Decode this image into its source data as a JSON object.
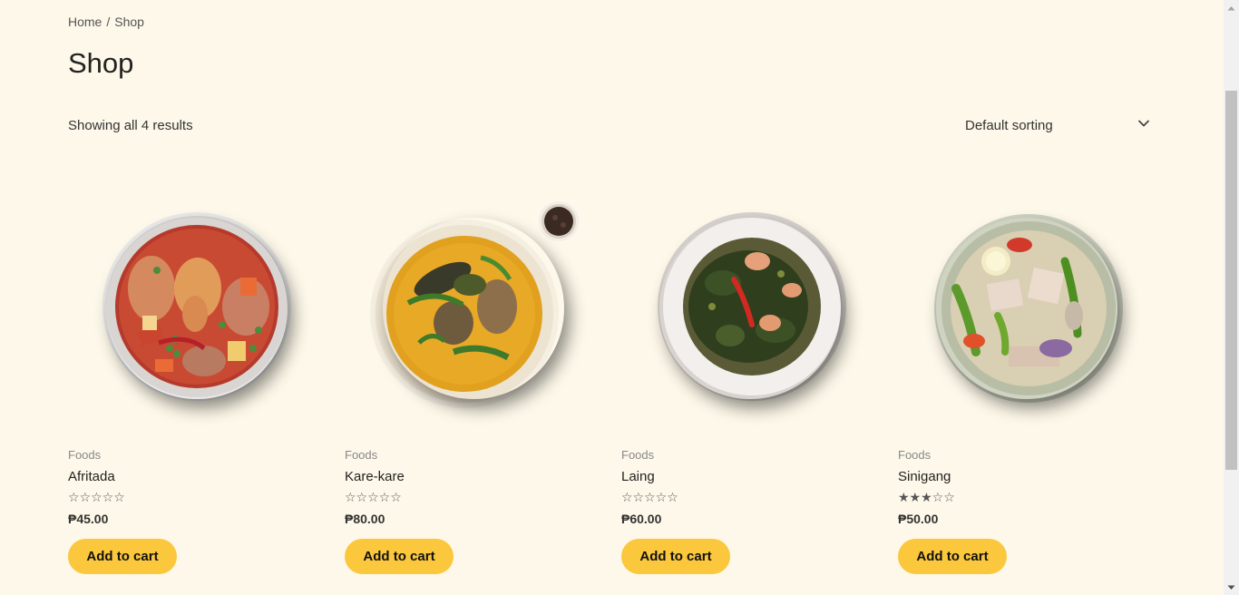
{
  "breadcrumb": {
    "home": "Home",
    "separator": "/",
    "current": "Shop"
  },
  "page_title": "Shop",
  "result_count": "Showing all 4 results",
  "sorting": {
    "selected": "Default sorting",
    "icon": "chevron-down-icon"
  },
  "colors": {
    "background": "#fdf8e9",
    "button": "#fbc73d",
    "star": "#555555"
  },
  "products": [
    {
      "category": "Foods",
      "name": "Afritada",
      "rating_stars": "☆☆☆☆☆",
      "rating": 0,
      "price": "₱45.00",
      "button": "Add to cart",
      "image": "afritada-dish"
    },
    {
      "category": "Foods",
      "name": "Kare-kare",
      "rating_stars": "☆☆☆☆☆",
      "rating": 0,
      "price": "₱80.00",
      "button": "Add to cart",
      "image": "kare-kare-dish"
    },
    {
      "category": "Foods",
      "name": "Laing",
      "rating_stars": "☆☆☆☆☆",
      "rating": 0,
      "price": "₱60.00",
      "button": "Add to cart",
      "image": "laing-dish"
    },
    {
      "category": "Foods",
      "name": "Sinigang",
      "rating_stars": "★★★☆☆",
      "rating": 3,
      "price": "₱50.00",
      "button": "Add to cart",
      "image": "sinigang-dish"
    }
  ]
}
